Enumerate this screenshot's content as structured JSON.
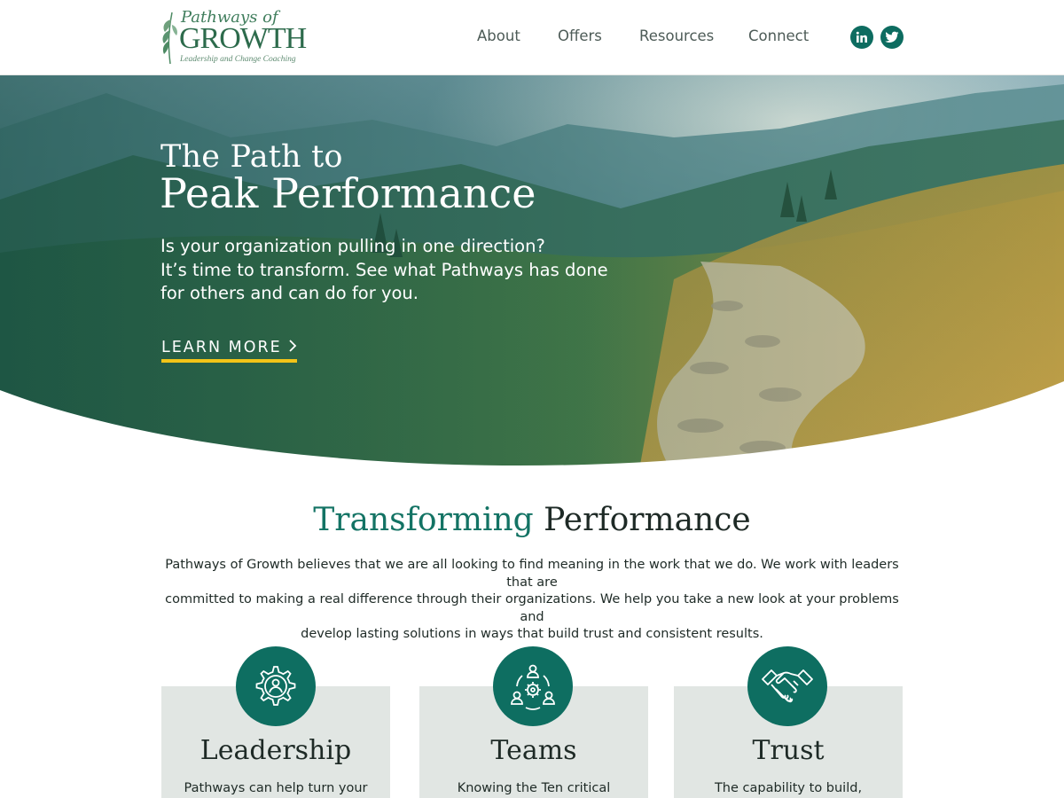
{
  "brand": {
    "line1": "Pathways of",
    "line2": "GROWTH",
    "tagline": "Leadership and Change Coaching"
  },
  "nav": {
    "items": [
      {
        "label": "About"
      },
      {
        "label": "Offers"
      },
      {
        "label": "Resources"
      },
      {
        "label": "Connect"
      }
    ],
    "social": [
      "linkedin-icon",
      "twitter-icon"
    ]
  },
  "hero": {
    "title_line1": "The Path to",
    "title_line2": "Peak Performance",
    "text_line1": "Is your organization pulling in one direction?",
    "text_line2": "It’s time to transform. See what Pathways has done",
    "text_line3": "for others and can do for you.",
    "cta": "LEARN MORE",
    "cta_icon": "chevron-right-icon"
  },
  "intro": {
    "title_accent": "Transforming",
    "title_rest": "Performance",
    "line1": "Pathways of Growth believes that we are all looking to find meaning in the work that we do. We work with leaders that are",
    "line2": "committed to making a real difference through their organizations.  We help you take a new look at your problems and",
    "line3": "develop lasting solutions in ways that build trust and consistent results."
  },
  "cards": [
    {
      "title": "Leadership",
      "text": "Pathways can help turn your",
      "icon": "gear-person-icon"
    },
    {
      "title": "Teams",
      "text": "Knowing the Ten critical",
      "icon": "team-cycle-icon"
    },
    {
      "title": "Trust",
      "text": "The capability to build,",
      "icon": "handshake-icon"
    }
  ],
  "colors": {
    "accent": "#0e6e61",
    "cta_underline": "#f2c418",
    "card_bg": "#e1e6e3"
  }
}
